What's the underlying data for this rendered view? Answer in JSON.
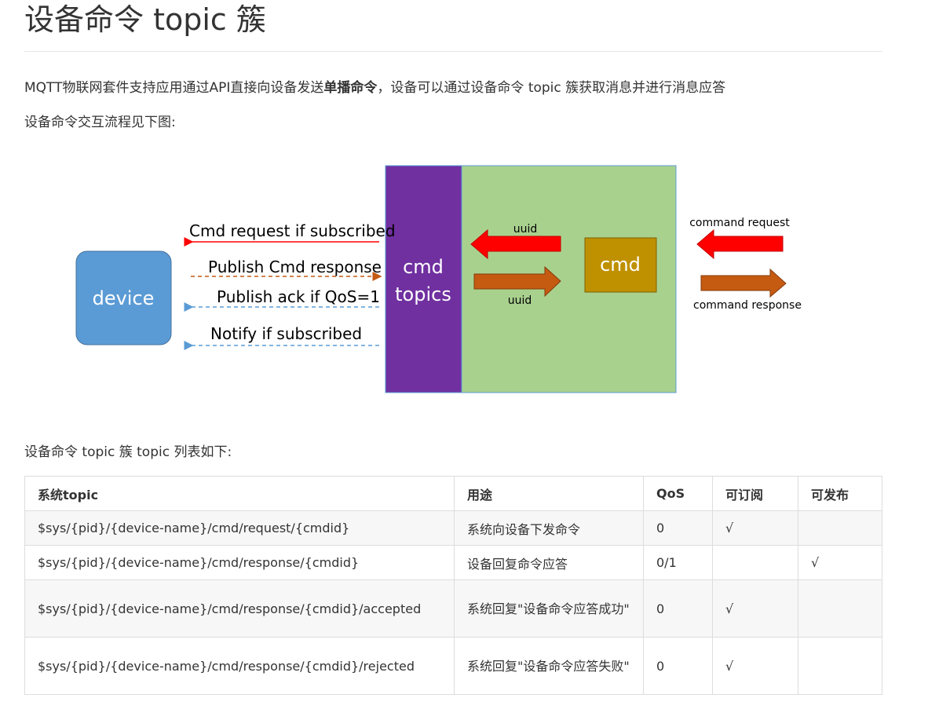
{
  "title": "设备命令 topic 簇",
  "intro": {
    "before": "MQTT物联网套件支持应用通过API直接向设备发送",
    "bold": "单播命令",
    "after": "，设备可以通过设备命令 topic 簇获取消息并进行消息应答"
  },
  "flow_caption": "设备命令交互流程见下图:",
  "diagram": {
    "device": "device",
    "cmd_topics_line1": "cmd",
    "cmd_topics_line2": "topics",
    "cmd": "cmd",
    "arrow_labels": {
      "cmd_request": "Cmd request if subscribed",
      "publish_response": "Publish Cmd response",
      "publish_ack": "Publish ack if QoS=1",
      "notify": "Notify if subscribed",
      "uuid_top": "uuid",
      "uuid_bottom": "uuid",
      "command_request": "command request",
      "command_response": "command response"
    },
    "colors": {
      "device": "#5b9bd5",
      "topics": "#7030a0",
      "green": "#a9d18e",
      "cmd": "#bf9000",
      "red": "#ff0000",
      "orange": "#c55a11"
    }
  },
  "list_caption": "设备命令 topic 簇 topic 列表如下:",
  "table": {
    "headers": [
      "系统topic",
      "用途",
      "QoS",
      "可订阅",
      "可发布"
    ],
    "rows": [
      {
        "topic": "$sys/{pid}/{device-name}/cmd/request/{cmdid}",
        "use": "系统向设备下发命令",
        "qos": "0",
        "sub": "√",
        "pub": ""
      },
      {
        "topic": "$sys/{pid}/{device-name}/cmd/response/{cmdid}",
        "use": "设备回复命令应答",
        "qos": "0/1",
        "sub": "",
        "pub": "√"
      },
      {
        "topic": "$sys/{pid}/{device-name}/cmd/response/{cmdid}/accepted",
        "use": "系统回复\"设备命令应答成功\"",
        "qos": "0",
        "sub": "√",
        "pub": ""
      },
      {
        "topic": "$sys/{pid}/{device-name}/cmd/response/{cmdid}/rejected",
        "use": "系统回复\"设备命令应答失败\"",
        "qos": "0",
        "sub": "√",
        "pub": ""
      }
    ]
  }
}
